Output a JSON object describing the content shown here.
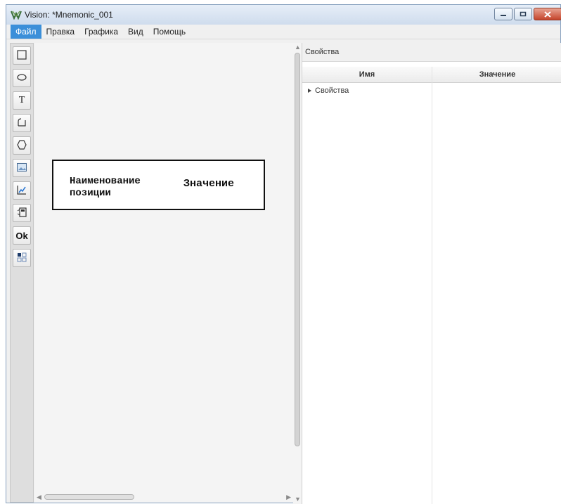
{
  "window": {
    "title": "Vision: *Mnemonic_001"
  },
  "menu": {
    "items": [
      "Файл",
      "Правка",
      "Графика",
      "Вид",
      "Помощь"
    ],
    "active": "Файл"
  },
  "toolbar": {
    "tools": [
      {
        "icon": "rectangle-icon"
      },
      {
        "icon": "ellipse-icon"
      },
      {
        "icon": "text-icon",
        "glyph": "T"
      },
      {
        "icon": "polyline-icon"
      },
      {
        "icon": "hexagon-icon"
      },
      {
        "icon": "image-icon"
      },
      {
        "icon": "trend-chart-icon"
      },
      {
        "icon": "value-display-icon"
      },
      {
        "icon": "ok-button-icon",
        "glyph": "Ok"
      },
      {
        "icon": "grid-icon"
      }
    ]
  },
  "canvas": {
    "element": {
      "name_label": "Наименование\nпозиции",
      "value_label": "Значение"
    }
  },
  "properties": {
    "title": "Свойства",
    "columns": {
      "name": "Имя",
      "value": "Значение"
    },
    "tree": [
      {
        "label": "Свойства",
        "expanded": false
      }
    ]
  },
  "colors": {
    "menu_active": "#3b8fd9",
    "close_button": "#c5442b"
  }
}
